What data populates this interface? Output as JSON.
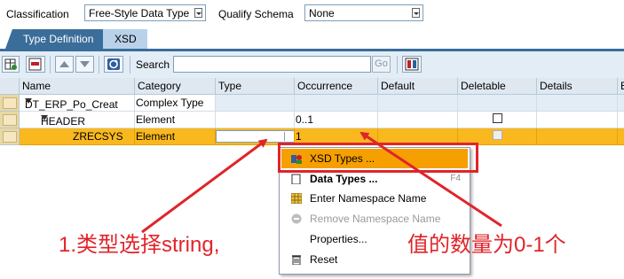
{
  "top": {
    "classification_label": "Classification",
    "classification_value": "Free-Style Data Type",
    "qualify_label": "Qualify Schema",
    "qualify_value": "None"
  },
  "tabs": [
    {
      "label": "Type Definition",
      "active": true
    },
    {
      "label": "XSD",
      "active": false
    }
  ],
  "toolbar": {
    "search_label": "Search",
    "search_value": "",
    "go_label": "Go"
  },
  "table": {
    "columns": [
      "Name",
      "Category",
      "Type",
      "Occurrence",
      "Default",
      "Deletable",
      "Details",
      "E"
    ],
    "rows": [
      {
        "name": "DT_ERP_Po_Creat",
        "category": "Complex Type",
        "type": "",
        "occurrence": "",
        "default": "",
        "deletable": null,
        "details": ""
      },
      {
        "name": "HEADER",
        "category": "Element",
        "type": "",
        "occurrence": "0..1",
        "default": "",
        "deletable": false,
        "details": ""
      },
      {
        "name": "ZRECSYS",
        "category": "Element",
        "type": "",
        "occurrence": "1",
        "default": "",
        "deletable": false,
        "details": "",
        "selected": true
      }
    ]
  },
  "context_menu": {
    "items": [
      {
        "label": "XSD Types ...",
        "icon": "xsd-types-icon",
        "highlighted": true,
        "enabled": true,
        "shortcut": ""
      },
      {
        "label": "Data Types ...",
        "icon": "data-types-icon",
        "highlighted": false,
        "enabled": true,
        "shortcut": "F4"
      },
      {
        "label": "Enter Namespace Name",
        "icon": "namespace-icon",
        "highlighted": false,
        "enabled": true,
        "shortcut": ""
      },
      {
        "label": "Remove Namespace Name",
        "icon": "remove-namespace-icon",
        "highlighted": false,
        "enabled": false,
        "shortcut": ""
      },
      {
        "label": "Properties...",
        "icon": "",
        "highlighted": false,
        "enabled": true,
        "shortcut": ""
      },
      {
        "label": "Reset",
        "icon": "trash-icon",
        "highlighted": false,
        "enabled": true,
        "shortcut": ""
      }
    ]
  },
  "annotations": {
    "left_note": "1.类型选择string,",
    "right_note": "值的数量为0-1个",
    "color": "#e0242a"
  },
  "colors": {
    "tab_active": "#3a6d99",
    "tab_inactive": "#b9d2ea",
    "selected_row": "#f9b81e",
    "menu_highlight": "#f59f00"
  }
}
